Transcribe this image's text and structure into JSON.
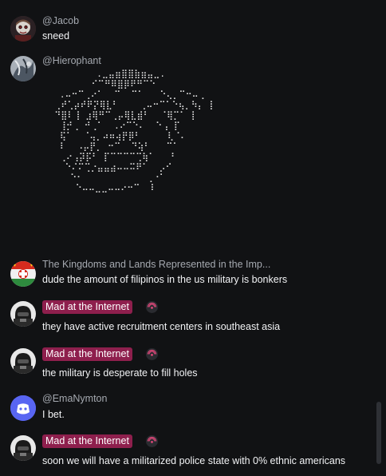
{
  "messages": [
    {
      "author": "@Jacob",
      "text": "sneed",
      "avatar_icon": "cartoon-character-avatar-icon"
    },
    {
      "author": "@Hierophant",
      "ascii_art": "          .⣀⣤⣶⣿⣿⣷⣶⣤⣀.\n         ⠊⠉⠛⠿⣿⡿⠟⠛⠉⠑\n   .⠤⠒⠉⢀⠔⠁  ⠉  ⠉⠁   ⠑⢄⡀⠉⠒⠤⢀\n  ⢀⠞⢁⡴⠞⠟⡝⢿⣇⠃    ⢀⠤⠒⠉⠁⠑⢦⡀⠳⡄ ⡇\n  ⠙⣿⠇⢸ ⣰⢿⠛⠉⢀⡤⢿⣇⣾⠃  ⠈⢿⡉⠁ ⡇\n   ⢸⡚⢀ ⠚⢀⠁  .⠔⠉⠑⠄  ⠑⢠ ⡏\n   ⢯⠁  ⠈⢤⡀⠴⠶⢴⡟⡿⠃     ⢇⠈⠄\n   ⠇  ⠠⡤⡟⡀ ⠒⠉  ⠙⢵⠃   ⠉⠁\n   ⢀⠔⢠⡽⡯⠃ ⡏⠉⠉⠉⠉⢉⢷⠁   ⠃\n    ⠑⠌⠍⢉⡐⣤⣤⣴⠤⠤⠭⠟⠁  ⡠⠊\n     ⠑⠂            ⢀⠐⠁\n      ⠑⠤⠤⣀⣀⠤⠤⠔⠒⠉  ⠇",
      "avatar_icon": "hierophant-avatar-icon"
    },
    {
      "author": "The Kingdoms and Lands Represented in the Imp...",
      "text": "dude the amount of filipinos in the us military is bonkers",
      "avatar_icon": "flag-avatar-icon"
    },
    {
      "author": "Mad at the Internet",
      "text": "they have active recruitment centers in southeast asia",
      "avatar_icon": "helmet-avatar-icon",
      "badge_icon": "broadcast-badge-icon"
    },
    {
      "author": "Mad at the Internet",
      "text": "the military is desperate to fill holes",
      "avatar_icon": "helmet-avatar-icon",
      "badge_icon": "broadcast-badge-icon"
    },
    {
      "author": "@EmaNymton",
      "text": "I bet.",
      "avatar_icon": "default-discord-avatar-icon"
    },
    {
      "author": "Mad at the Internet",
      "text": "soon we will have a militarized police state with 0% ethnic americans",
      "avatar_icon": "helmet-avatar-icon",
      "badge_icon": "broadcast-badge-icon"
    }
  ],
  "colors": {
    "background": "#111214",
    "role_tag": "#8e1f4d",
    "badge_ring": "#e0487a",
    "default_avatar": "#5865f2",
    "muted_name": "#a5a9b0",
    "text": "#f2f3f5"
  }
}
